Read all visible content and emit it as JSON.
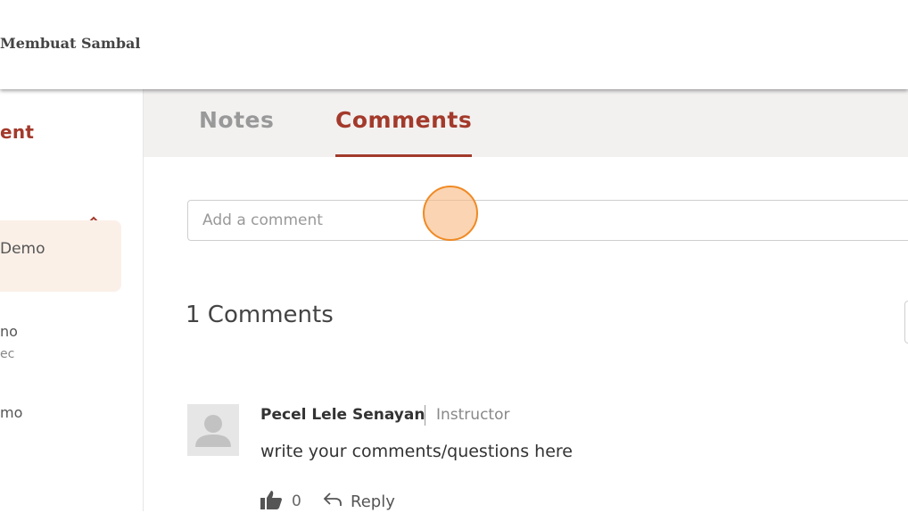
{
  "header": {
    "course_title": "Membuat Sambal"
  },
  "sidebar": {
    "section_title": "ent",
    "active_lesson_label": "Demo",
    "lesson2_title": "no",
    "lesson2_subtitle": "ec",
    "lesson3_title": "mo"
  },
  "tabs": [
    {
      "label": "Notes",
      "active": false
    },
    {
      "label": "Comments",
      "active": true
    }
  ],
  "comment_form": {
    "placeholder": "Add a comment"
  },
  "comments_section": {
    "count_heading": "1 Comments"
  },
  "comments": [
    {
      "author": "Pecel Lele Senayan",
      "role": "Instructor",
      "body": "write your comments/questions here",
      "likes": "0",
      "reply_label": "Reply"
    }
  ],
  "colors": {
    "accent": "#a33a2b",
    "active_lesson_bg": "#fbf0e8",
    "tabs_bg": "#f2f1f0"
  }
}
